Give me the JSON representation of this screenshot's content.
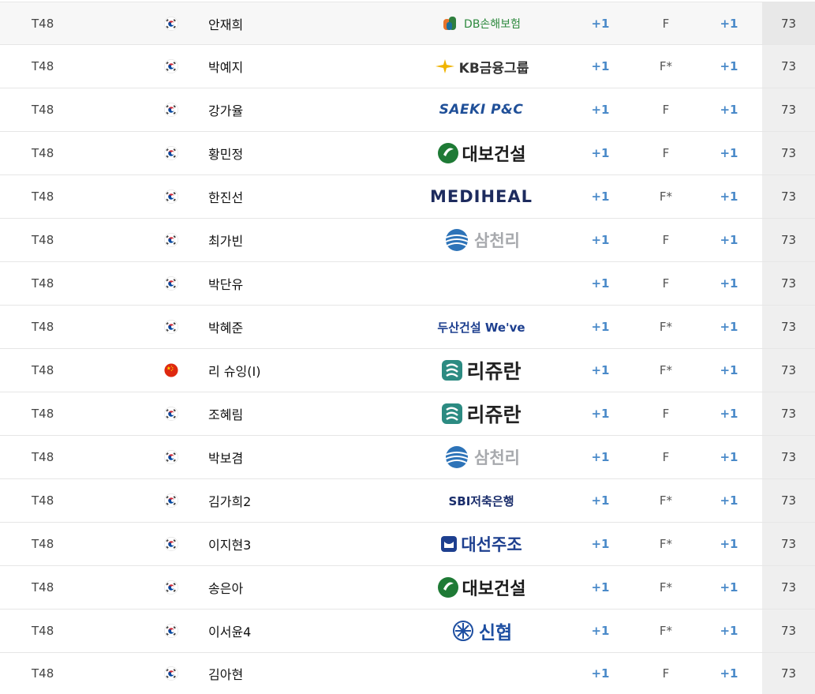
{
  "leaderboard": {
    "rows": [
      {
        "rank": "T48",
        "country": "KOR",
        "name": "안재희",
        "sponsor": "DB손해보험",
        "sponsor_logo": "db-insurance",
        "today": "+1",
        "thru": "F",
        "total": "+1",
        "score": "73"
      },
      {
        "rank": "T48",
        "country": "KOR",
        "name": "박예지",
        "sponsor": "KB금융그룹",
        "sponsor_logo": "kb-financial",
        "today": "+1",
        "thru": "F*",
        "total": "+1",
        "score": "73"
      },
      {
        "rank": "T48",
        "country": "KOR",
        "name": "강가율",
        "sponsor": "SAEKI P&C",
        "sponsor_logo": "saeki",
        "today": "+1",
        "thru": "F",
        "total": "+1",
        "score": "73"
      },
      {
        "rank": "T48",
        "country": "KOR",
        "name": "황민정",
        "sponsor": "대보건설",
        "sponsor_logo": "daebo",
        "today": "+1",
        "thru": "F",
        "total": "+1",
        "score": "73"
      },
      {
        "rank": "T48",
        "country": "KOR",
        "name": "한진선",
        "sponsor": "MEDIHEAL",
        "sponsor_logo": "mediheal",
        "today": "+1",
        "thru": "F*",
        "total": "+1",
        "score": "73"
      },
      {
        "rank": "T48",
        "country": "KOR",
        "name": "최가빈",
        "sponsor": "삼천리",
        "sponsor_logo": "samchully",
        "today": "+1",
        "thru": "F",
        "total": "+1",
        "score": "73"
      },
      {
        "rank": "T48",
        "country": "KOR",
        "name": "박단유",
        "sponsor": "",
        "sponsor_logo": "",
        "today": "+1",
        "thru": "F",
        "total": "+1",
        "score": "73"
      },
      {
        "rank": "T48",
        "country": "KOR",
        "name": "박혜준",
        "sponsor": "두산건설 We've",
        "sponsor_logo": "doosan",
        "today": "+1",
        "thru": "F*",
        "total": "+1",
        "score": "73"
      },
      {
        "rank": "T48",
        "country": "CHN",
        "name": "리 슈잉(I)",
        "sponsor": "리쥬란",
        "sponsor_logo": "rejuran",
        "today": "+1",
        "thru": "F*",
        "total": "+1",
        "score": "73"
      },
      {
        "rank": "T48",
        "country": "KOR",
        "name": "조혜림",
        "sponsor": "리쥬란",
        "sponsor_logo": "rejuran",
        "today": "+1",
        "thru": "F",
        "total": "+1",
        "score": "73"
      },
      {
        "rank": "T48",
        "country": "KOR",
        "name": "박보겸",
        "sponsor": "삼천리",
        "sponsor_logo": "samchully",
        "today": "+1",
        "thru": "F",
        "total": "+1",
        "score": "73"
      },
      {
        "rank": "T48",
        "country": "KOR",
        "name": "김가희2",
        "sponsor": "SBI저축은행",
        "sponsor_logo": "sbi",
        "today": "+1",
        "thru": "F*",
        "total": "+1",
        "score": "73"
      },
      {
        "rank": "T48",
        "country": "KOR",
        "name": "이지현3",
        "sponsor": "대선주조",
        "sponsor_logo": "daesun",
        "today": "+1",
        "thru": "F*",
        "total": "+1",
        "score": "73"
      },
      {
        "rank": "T48",
        "country": "KOR",
        "name": "송은아",
        "sponsor": "대보건설",
        "sponsor_logo": "daebo",
        "today": "+1",
        "thru": "F*",
        "total": "+1",
        "score": "73"
      },
      {
        "rank": "T48",
        "country": "KOR",
        "name": "이서윤4",
        "sponsor": "신협",
        "sponsor_logo": "shinhyup",
        "today": "+1",
        "thru": "F*",
        "total": "+1",
        "score": "73"
      },
      {
        "rank": "T48",
        "country": "KOR",
        "name": "김아현",
        "sponsor": "",
        "sponsor_logo": "",
        "today": "+1",
        "thru": "F",
        "total": "+1",
        "score": "73"
      }
    ]
  },
  "colors": {
    "score_blue": "#4a8ac9",
    "row_border": "#e6e6e6",
    "score_column_bg": "#efefef"
  }
}
